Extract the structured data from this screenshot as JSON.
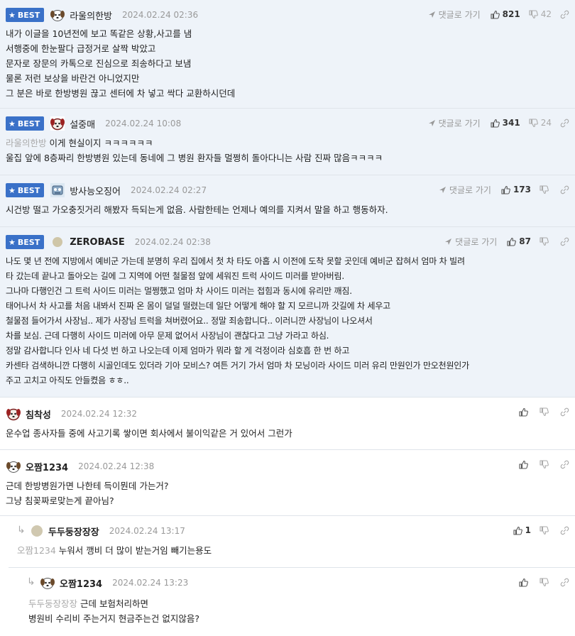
{
  "labels": {
    "best": "BEST",
    "reply_to": "댓글로 가기"
  },
  "comments": [
    {
      "best": true,
      "avatar": "puppy-icon",
      "nick": "라울의한방",
      "date": "2024.02.24 02:36",
      "up": "821",
      "down": "42",
      "mention": "",
      "lines": [
        "내가 이글을 10년전에 보고 똑같은 상황,사고를 냄",
        "서행중에 한눈팔다 급정거로 살짝 박았고",
        "문자로 장문의 카톡으로 진심으로 죄송하다고 보냄",
        "물론 저런 보상을 바란건 아니었지만",
        "그 분은 바로 한방병원 끊고 센터에 차 넣고 싹다 교환하시던데"
      ]
    },
    {
      "best": true,
      "avatar": "red-dog-icon",
      "nick": "설중매",
      "date": "2024.02.24 10:08",
      "up": "341",
      "down": "24",
      "mention": "라울의한방",
      "lines": [
        "이게 현실이지 ㅋㅋㅋㅋㅋㅋ",
        "울집 앞에 8층짜리 한방병원 있는데 동네에 그 병원 환자들 멀쩡히 돌아다니는 사람 진짜 많음ㅋㅋㅋㅋ"
      ]
    },
    {
      "best": true,
      "avatar": "robot-icon",
      "nick": "방사능오징어",
      "date": "2024.02.24 02:27",
      "up": "173",
      "down": "",
      "mention": "",
      "lines": [
        "시건방 떨고 가오충짓거리 해봤자 득되는게 없음. 사람한테는 언제나 예의를 지켜서 말을 하고 행동하자."
      ]
    },
    {
      "best": true,
      "avatar": "dot-icon",
      "nick": "ZEROBASE",
      "date": "2024.02.24 02:38",
      "up": "87",
      "down": "",
      "mention": "",
      "lines": [
        "나도 몇 년 전에 지방에서 예비군 가는데 분명히 우리 집에서 첫 차 타도 아홉 시 이전에 도착 못할 곳인데 예비군 잡혀서 엄마 차 빌려",
        "타 갔는데 끝나고 돌아오는 길에 그 지역에 어떤 철물점 앞에 세워진 트럭 사이드 미러를 받아버림.",
        "그나마 다행인건 그 트럭 사이드 미러는 멀쩡했고 엄마 차 사이드 미러는 접힘과 동시에 유리만 깨짐.",
        "태어나서 차 사고를 처음 내봐서 진짜 온 몸이 덜덜 떨렸는데 일단 어떻게 해야 할 지 모르니까 갓길에 차 세우고",
        "철물점 들어가서 사장님.. 제가 사장님 트럭을 쳐버렸어요.. 정말 죄송합니다.. 이러니깐 사장님이 나오셔서",
        "차를 보심. 근데 다행히 사이드 미러에 아무 문제 없어서 사장님이 괜찮다고 그냥 가라고 하심.",
        "정말 감사합니다 인사 네 다섯 번 하고 나오는데 이제 엄마가 뭐라 할 게 걱정이라 심호흡 한 번 하고",
        "카센타 검색하니깐 다행히 시골인데도 있더라 기아 모비스? 여튼 거기 가서 엄마 차 모닝이라 사이드 미러 유리 만원인가 만오천원인가",
        "주고 고치고 아직도 안들켰음 ㅎㅎ.."
      ]
    },
    {
      "best": false,
      "avatar": "red-dog-icon",
      "nick": "침착성",
      "date": "2024.02.24 12:32",
      "up": "",
      "down": "",
      "mention": "",
      "lines": [
        "운수업 종사자들 중에 사고기록 쌓이면 회사에서 불이익같은 거 있어서 그런가"
      ]
    },
    {
      "best": false,
      "avatar": "puppy-icon",
      "nick": "오짬1234",
      "date": "2024.02.24 12:38",
      "up": "",
      "down": "",
      "mention": "",
      "lines": [
        "근데 한방병원가면 나한테 득이뭔데 가는거?",
        "그냥 침꽂짜로맞는게 끝아님?"
      ]
    },
    {
      "best": false,
      "avatar": "dot-icon",
      "nick": "두두둥장장장",
      "date": "2024.02.24 13:17",
      "up": "1",
      "down": "",
      "mention": "오짬1234",
      "lines": [
        "누워서 깽비 더 많이 받는거임 빼기는용도"
      ]
    },
    {
      "best": false,
      "avatar": "puppy-icon",
      "nick": "오짬1234",
      "date": "2024.02.24 13:23",
      "up": "",
      "down": "",
      "mention": "두두둥장장장",
      "lines": [
        "근데 보험처리하면",
        "병원비 수리비 주는거지 현금주는건 없지않음?"
      ]
    }
  ]
}
